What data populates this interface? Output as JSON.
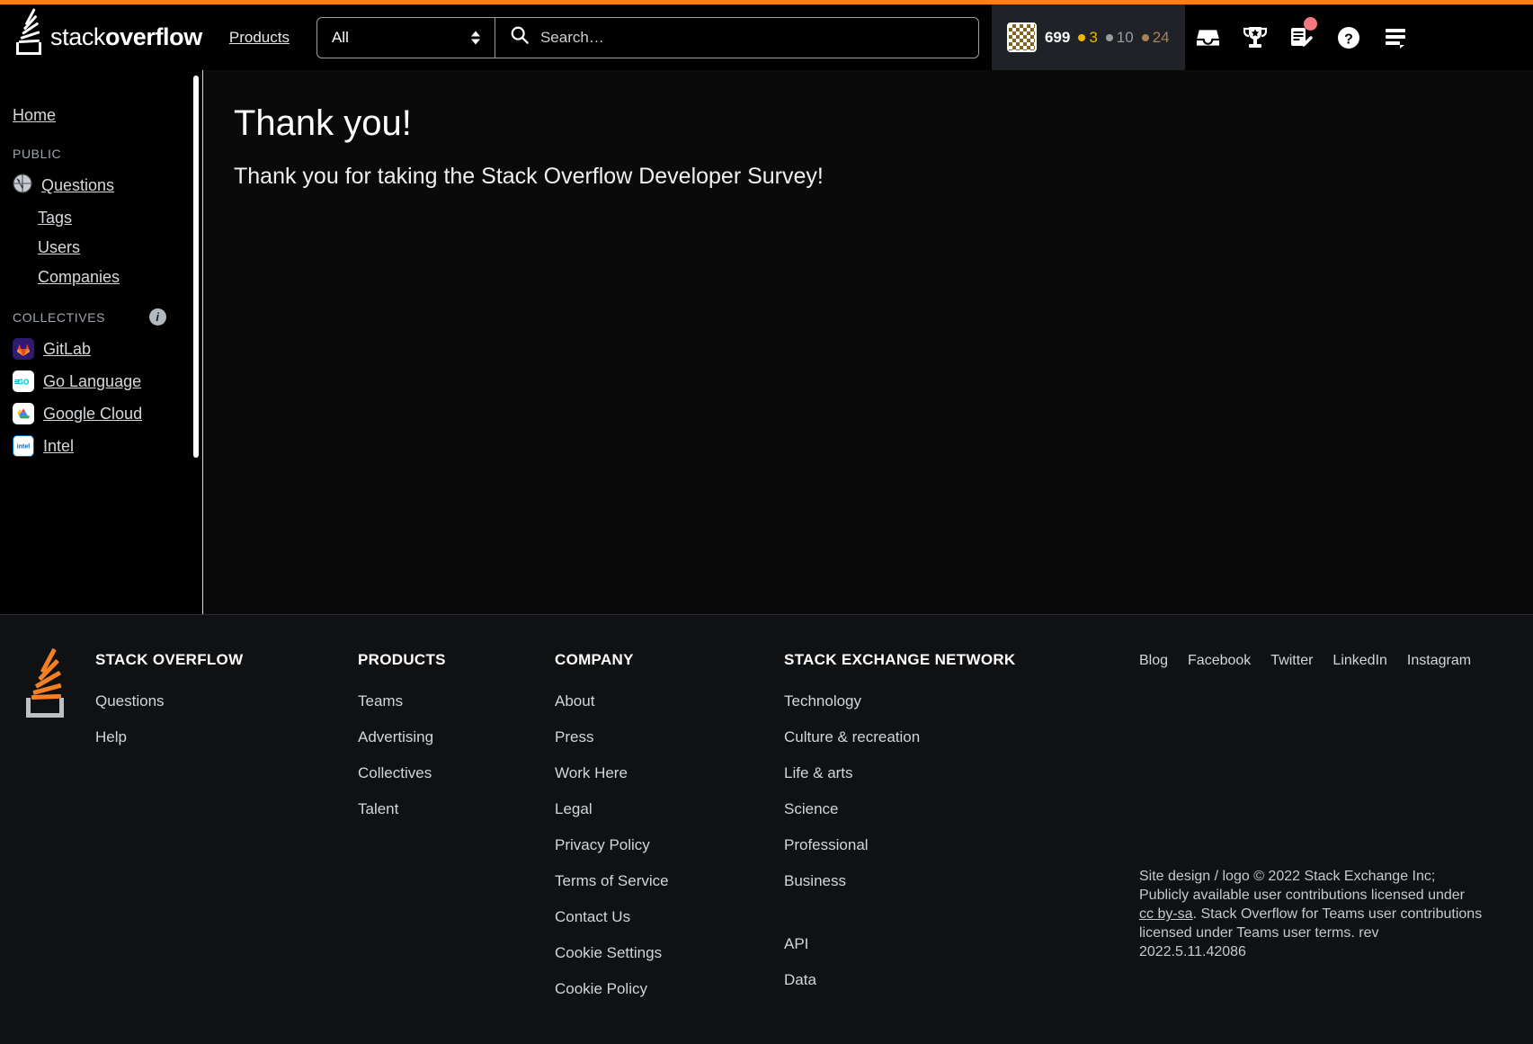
{
  "header": {
    "logo_text_light": "stack",
    "logo_text_bold": "overflow",
    "products_label": "Products",
    "search": {
      "scope_value": "All",
      "placeholder": "Search…",
      "input_value": ""
    },
    "user": {
      "reputation": "699",
      "gold": "3",
      "silver": "10",
      "bronze": "24",
      "gold_color": "#f1b600",
      "silver_color": "#9a9c9f",
      "bronze_color": "#ab8159"
    },
    "icons": [
      {
        "name": "inbox-icon",
        "label": "Inbox"
      },
      {
        "name": "trophy-icon",
        "label": "Achievements"
      },
      {
        "name": "review-queue-icon",
        "label": "Review queue",
        "badge": true
      },
      {
        "name": "help-icon",
        "label": "Help"
      },
      {
        "name": "stacks-menu-icon",
        "label": "Stack Exchange menu"
      }
    ]
  },
  "sidebar": {
    "home_label": "Home",
    "public_heading": "PUBLIC",
    "public_items": [
      {
        "label": "Questions",
        "icon": "globe-icon"
      },
      {
        "label": "Tags",
        "icon": ""
      },
      {
        "label": "Users",
        "icon": ""
      },
      {
        "label": "Companies",
        "icon": ""
      }
    ],
    "collectives_heading": "COLLECTIVES",
    "collectives_info_icon": "info-icon",
    "collectives": [
      {
        "label": "GitLab",
        "icon": "gitlab-logo-icon"
      },
      {
        "label": "Go Language",
        "icon": "go-logo-icon"
      },
      {
        "label": "Google Cloud",
        "icon": "google-cloud-logo-icon"
      },
      {
        "label": "Intel",
        "icon": "intel-logo-icon"
      }
    ]
  },
  "main": {
    "heading": "Thank you!",
    "body": "Thank you for taking the Stack Overflow Developer Survey!"
  },
  "footer": {
    "columns": [
      {
        "title": "STACK OVERFLOW",
        "links": [
          "Questions",
          "Help"
        ]
      },
      {
        "title": "PRODUCTS",
        "links": [
          "Teams",
          "Advertising",
          "Collectives",
          "Talent"
        ]
      },
      {
        "title": "COMPANY",
        "links": [
          "About",
          "Press",
          "Work Here",
          "Legal",
          "Privacy Policy",
          "Terms of Service",
          "Contact Us",
          "Cookie Settings",
          "Cookie Policy"
        ]
      },
      {
        "title": "STACK EXCHANGE NETWORK",
        "links": [
          "Technology",
          "Culture & recreation",
          "Life & arts",
          "Science",
          "Professional",
          "Business"
        ],
        "extra_links": [
          "API",
          "Data"
        ]
      }
    ],
    "social": [
      "Blog",
      "Facebook",
      "Twitter",
      "LinkedIn",
      "Instagram"
    ],
    "copyright_line1": "Site design / logo © 2022 Stack Exchange Inc; Publicly",
    "copyright_line2_pre": "available user contributions licensed under ",
    "copyright_license_link": "cc by-sa",
    "copyright_line2_post": ".",
    "copyright_line3": "Stack Overflow for Teams user contributions licensed",
    "copyright_line4": "under Teams user terms. rev 2022.5.11.42086"
  },
  "colors": {
    "accent_orange": "#f48024",
    "header_bg": "#000000",
    "page_bg": "#0a0a0a",
    "footer_bg": "#0f1113"
  }
}
